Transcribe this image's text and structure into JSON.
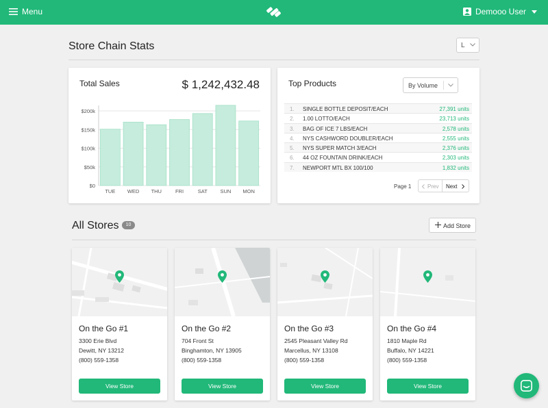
{
  "topbar": {
    "menu_label": "Menu",
    "user_label": "Demooo User",
    "brand_color": "#21b879"
  },
  "stats": {
    "title": "Store Chain Stats",
    "range_value": "L"
  },
  "total_sales": {
    "title": "Total Sales",
    "value": "$ 1,242,432.48"
  },
  "chart_data": {
    "type": "bar",
    "categories": [
      "TUE",
      "WED",
      "THU",
      "FRI",
      "SAT",
      "SUN",
      "MON"
    ],
    "values": [
      151000,
      170000,
      163000,
      177000,
      193000,
      215000,
      173000
    ],
    "ylim": [
      0,
      200000
    ],
    "yticks": [
      "$0",
      "$50k",
      "$100k",
      "$150k",
      "$200k"
    ],
    "bar_color": "#c5ecdc",
    "bar_stroke": "#a6e0c8"
  },
  "top_products": {
    "title": "Top Products",
    "sort_value": "By Volume",
    "rows": [
      {
        "num": "1.",
        "name": "SINGLE BOTTLE DEPOSIT/EACH",
        "units": "27,391 units"
      },
      {
        "num": "2.",
        "name": "1.00 LOTTO/EACH",
        "units": "23,713 units"
      },
      {
        "num": "3.",
        "name": "BAG OF ICE 7 LBS/EACH",
        "units": "2,578 units"
      },
      {
        "num": "4.",
        "name": "NYS CASHWORD DOUBLER/EACH",
        "units": "2,555 units"
      },
      {
        "num": "5.",
        "name": "NYS SUPER MATCH 3/EACH",
        "units": "2,376 units"
      },
      {
        "num": "6.",
        "name": "44 OZ FOUNTAIN DRINK/EACH",
        "units": "2,303 units"
      },
      {
        "num": "7.",
        "name": "NEWPORT MTL BX 100/100",
        "units": "1,832 units"
      }
    ],
    "page_label": "Page 1",
    "prev_label": "Prev",
    "next_label": "Next"
  },
  "stores": {
    "title": "All Stores",
    "count": "10",
    "add_label": "Add Store",
    "items": [
      {
        "name": "On the Go #1",
        "street": "3300 Erie Blvd",
        "city": "Dewitt, NY 13212",
        "phone": "(800) 559-1358",
        "button": "View Store"
      },
      {
        "name": "On the Go #2",
        "street": "704 Front St",
        "city": "Binghamton, NY 13905",
        "phone": "(800) 559-1358",
        "button": "View Store"
      },
      {
        "name": "On the Go #3",
        "street": "2545 Pleasant Valley Rd",
        "city": "Marcellus, NY 13108",
        "phone": "(800) 559-1358",
        "button": "View Store"
      },
      {
        "name": "On the Go #4",
        "street": "1810 Maple Rd",
        "city": "Buffalo, NY 14221",
        "phone": "(800) 559-1358",
        "button": "View Store"
      }
    ]
  }
}
